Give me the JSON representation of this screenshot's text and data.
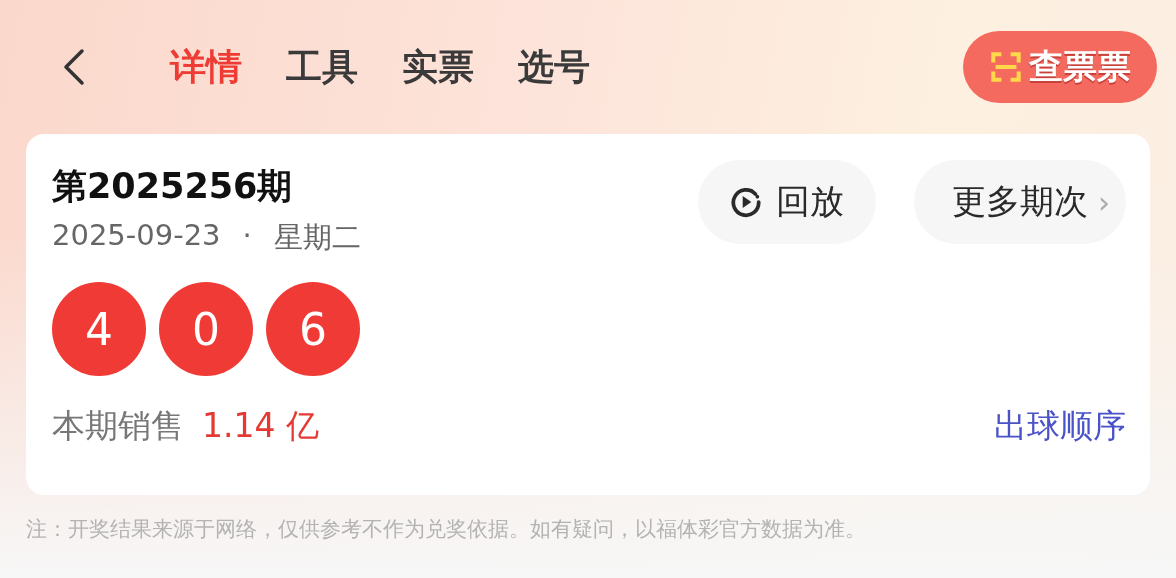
{
  "nav": {
    "tabs": [
      {
        "label": "详情",
        "selected": true
      },
      {
        "label": "工具",
        "selected": false
      },
      {
        "label": "实票",
        "selected": false
      },
      {
        "label": "选号",
        "selected": false
      }
    ],
    "scan_button": "查票票"
  },
  "draw": {
    "issue": "第2025256期",
    "date": "2025-09-23",
    "separator": "·",
    "weekday": "星期二",
    "replay_button": "回放",
    "more_button": "更多期次",
    "more_arrow": "›",
    "balls": [
      "4",
      "0",
      "6"
    ],
    "sales_label": "本期销售",
    "sales_value": "1.14 亿",
    "order_link": "出球顺序"
  },
  "note": "注：开奖结果来源于网络，仅供参考不作为兑奖依据。如有疑问，以福体彩官方数据为准。"
}
